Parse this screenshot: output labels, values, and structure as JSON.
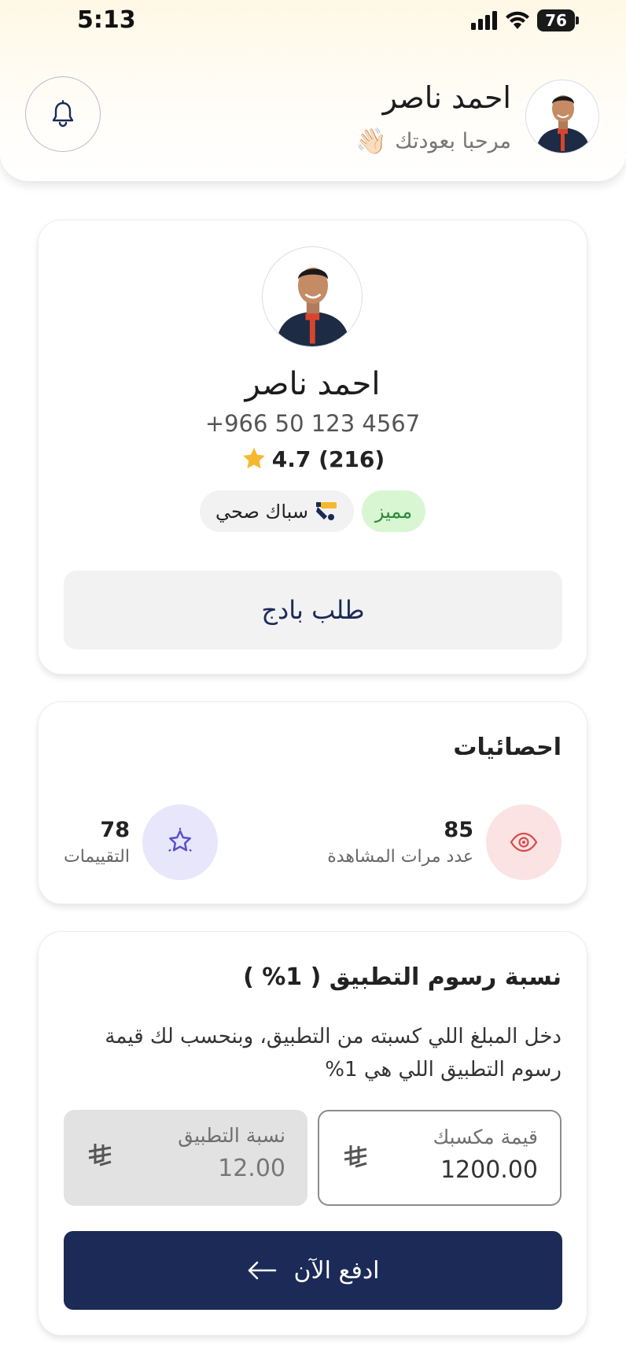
{
  "status_bar": {
    "time": "5:13",
    "battery": "76"
  },
  "header": {
    "name": "احمد ناصر",
    "greeting": "مرحبا بعودتك",
    "greeting_emoji": "👋🏻"
  },
  "profile": {
    "name": "احمد ناصر",
    "phone": "+966 50 123 4567",
    "rating": "4.7 (216)",
    "featured_label": "مميز",
    "category_label": "سباك صحي",
    "badge_request_label": "طلب بادج"
  },
  "stats": {
    "title": "احصائيات",
    "views": {
      "value": "85",
      "label": "عدد مرات المشاهدة"
    },
    "ratings": {
      "value": "78",
      "label": "التقييمات"
    }
  },
  "fees": {
    "title": "نسبة رسوم التطبيق ( 1% )",
    "description": "دخل المبلغ اللي كسبته من التطبيق، وبنحسب لك قيمة رسوم التطبيق اللي هي 1%",
    "earnings_label": "قيمة مكسبك",
    "earnings_value": "1200.00",
    "app_share_label": "نسبة التطبيق",
    "app_share_value": "12.00",
    "pay_label": "ادفع الآن"
  },
  "colors": {
    "primary": "#1b2a57",
    "featured_bg": "#d9f6d3",
    "featured_text": "#2e8a3a",
    "views_bg": "#fbe3e3",
    "views_icon": "#d94c4c",
    "ratings_bg": "#e8e6fb",
    "ratings_icon": "#5b4fd0",
    "star": "#f5b82e"
  },
  "icons": {
    "bell": "bell-icon",
    "star": "star-icon",
    "plumber": "plumber-icon",
    "eye": "eye-icon",
    "badge_star": "star-badge-icon",
    "currency": "riyal-icon",
    "arrow": "arrow-left-icon"
  }
}
